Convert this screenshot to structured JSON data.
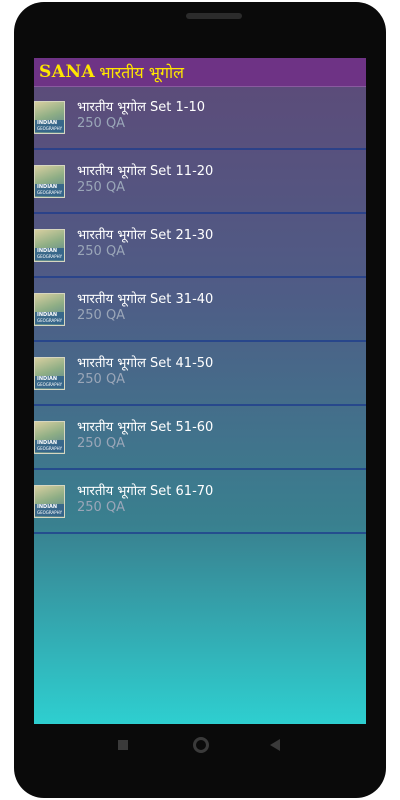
{
  "appbar": {
    "brand": "SANA",
    "title": "भारतीय भूगोल"
  },
  "list": {
    "items": [
      {
        "title": "भारतीय भूगोल Set 1-10",
        "subtitle": "250 QA",
        "thumb_line1": "INDIAN",
        "thumb_line2": "GEOGRAPHY"
      },
      {
        "title": "भारतीय भूगोल Set 11-20",
        "subtitle": "250 QA",
        "thumb_line1": "INDIAN",
        "thumb_line2": "GEOGRAPHY"
      },
      {
        "title": "भारतीय भूगोल Set 21-30",
        "subtitle": "250 QA",
        "thumb_line1": "INDIAN",
        "thumb_line2": "GEOGRAPHY"
      },
      {
        "title": "भारतीय भूगोल Set 31-40",
        "subtitle": "250 QA",
        "thumb_line1": "INDIAN",
        "thumb_line2": "GEOGRAPHY"
      },
      {
        "title": "भारतीय भूगोल Set 41-50",
        "subtitle": "250 QA",
        "thumb_line1": "INDIAN",
        "thumb_line2": "GEOGRAPHY"
      },
      {
        "title": "भारतीय भूगोल Set 51-60",
        "subtitle": "250 QA",
        "thumb_line1": "INDIAN",
        "thumb_line2": "GEOGRAPHY"
      },
      {
        "title": "भारतीय भूगोल Set 61-70",
        "subtitle": "250 QA",
        "thumb_line1": "INDIAN",
        "thumb_line2": "GEOGRAPHY"
      }
    ]
  },
  "navbar": {
    "recents_icon": "square-icon",
    "home_icon": "circle-icon",
    "back_icon": "triangle-back-icon"
  },
  "colors": {
    "appbar_bg": "#6e3385",
    "title_color": "#ffe600",
    "gradient_top": "#5d4a78",
    "gradient_bottom": "#2ecfd0"
  }
}
